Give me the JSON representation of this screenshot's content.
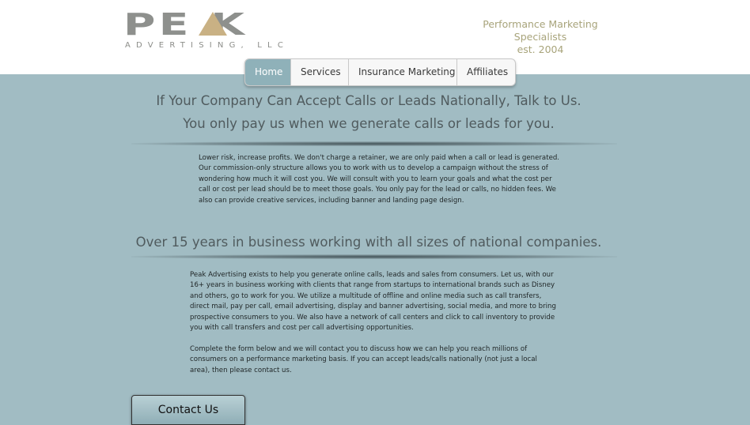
{
  "logo": {
    "wordmark": "PE  K",
    "subtitle": "ADVERTISING, LLC"
  },
  "tagline": {
    "line1": "Performance Marketing Specialists",
    "line2": "est. 2004"
  },
  "nav": {
    "items": [
      {
        "label": "Home",
        "active": true
      },
      {
        "label": "Services"
      },
      {
        "label": "Insurance Marketing"
      },
      {
        "label": "Affiliates"
      }
    ]
  },
  "main": {
    "headline1": "If Your Company Can Accept Calls or Leads Nationally, Talk to Us.",
    "headline2": "You only pay us when we generate calls or leads for you.",
    "paragraph1": "Lower risk,  increase profits.  We don't charge a retainer, we are only paid when a call or lead is generated. Our commission-only structure allows you to work with us to develop a campaign without the stress of wondering how much it will cost you.  We will consult with you to learn your goals and what the cost per call or cost per lead should be to meet those goals.  You only pay for the lead or calls, no hidden fees.  We also can provide creative services, including banner and landing page design.",
    "headline3": "Over 15 years in business working with all sizes of national companies.",
    "paragraph2": "Peak Advertising exists to help you generate online calls, leads and sales from consumers.  Let us, with our 16+ years in business working with clients that range from startups to international brands such as Disney and others, go to work for you.  We utilize a multitude of offline and online media such as call transfers, direct mail, pay per call, email advertising, display and banner advertising, social media, and more to bring prospective consumers to you.  We also have a network of call centers and click to call inventory to provide you with call transfers and cost per call advertising opportunities.",
    "paragraph3": "Complete the form below and we will contact you to discuss how we can help you reach millions of consumers on a performance marketing basis.  If you can accept leads/calls nationally (not just a local area), then please contact us.",
    "contact_label": "Contact Us"
  },
  "colors": {
    "background": "#a1bcc3",
    "nav_active": "#8fb1b9",
    "logo_gold": "#c9b184",
    "tagline": "#a8a47b"
  }
}
